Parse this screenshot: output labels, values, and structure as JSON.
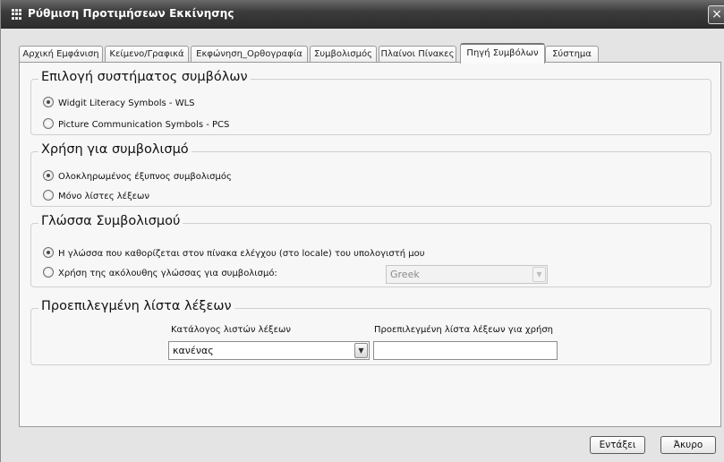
{
  "window": {
    "title": "Ρύθμιση Προτιμήσεων Εκκίνησης",
    "close_glyph": "×"
  },
  "tabs": [
    {
      "label": "Αρχική Εμφάνιση",
      "active": false
    },
    {
      "label": "Κείμενο/Γραφικά",
      "active": false
    },
    {
      "label": "Εκφώνηση_Ορθογραφία",
      "active": false
    },
    {
      "label": "Συμβολισμός",
      "active": false
    },
    {
      "label": "Πλαίνοι Πίνακες",
      "active": false
    },
    {
      "label": "Πηγή Συμβόλων",
      "active": true
    },
    {
      "label": "Σύστημα",
      "active": false
    }
  ],
  "groups": {
    "symbol_system": {
      "legend": "Επιλογή συστήματος συμβόλων",
      "options": [
        {
          "label": "Widgit Literacy Symbols - WLS",
          "checked": true
        },
        {
          "label": "Picture Communication Symbols - PCS",
          "checked": false
        }
      ]
    },
    "symbolisation_use": {
      "legend": "Χρήση για συμβολισμό",
      "options": [
        {
          "label": "Ολοκληρωμένος έξυπνος συμβολισμός",
          "checked": true
        },
        {
          "label": "Μόνο λίστες λέξεων",
          "checked": false
        }
      ]
    },
    "symbolisation_language": {
      "legend": "Γλώσσα Συμβολισμού",
      "options": [
        {
          "label": "Η γλώσσα που καθορίζεται στον πίνακα ελέγχου (στο locale) του υπολογιστή μου",
          "checked": true
        },
        {
          "label": "Χρήση της ακόλουθης γλώσσας για συμβολισμό:",
          "checked": false
        }
      ],
      "language_select": {
        "value": "Greek",
        "enabled": false
      }
    },
    "default_wordlist": {
      "legend": "Προεπιλεγμένη λίστα λέξεων",
      "catalog_label": "Κατάλογος λιστών λέξεων",
      "catalog_value": "κανένας",
      "default_label": "Προεπιλεγμένη λίστα λέξεων για χρήση",
      "default_value": ""
    }
  },
  "buttons": {
    "ok": "Εντάξει",
    "cancel": "Άκυρο"
  },
  "icons": {
    "dropdown": "▼",
    "app": "grid-icon"
  }
}
